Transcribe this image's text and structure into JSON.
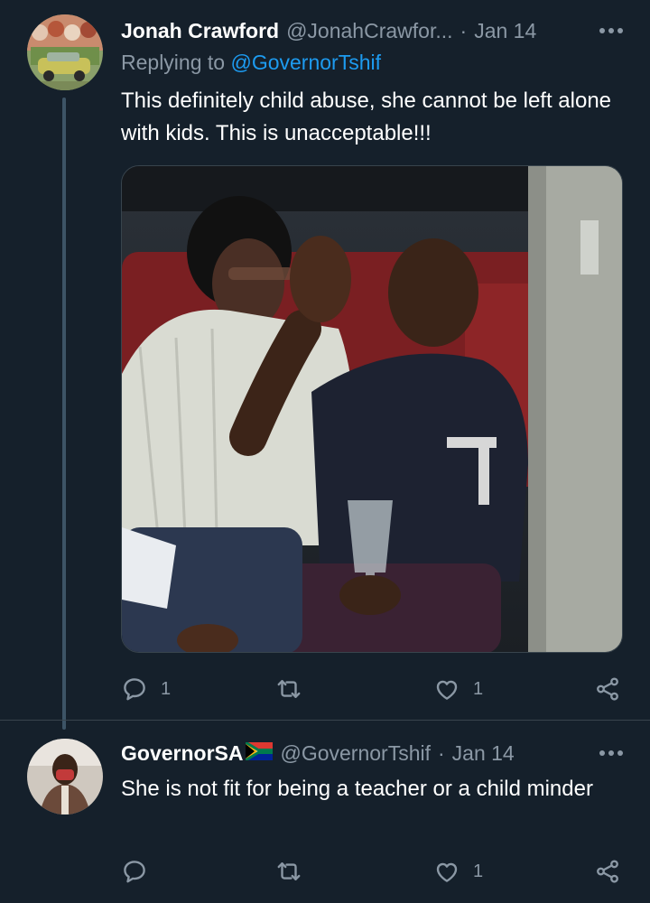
{
  "tweets": [
    {
      "author": {
        "name": "Jonah Crawford",
        "handle": "@JonahCrawfor...",
        "date": "Jan 14",
        "separator": "·"
      },
      "replying_prefix": "Replying to",
      "replying_to": "@GovernorTshif",
      "text": "This definitely child abuse, she cannot be left alone with kids. This is unacceptable!!!",
      "actions": {
        "reply_count": "1",
        "retweet_count": "",
        "like_count": "1"
      }
    },
    {
      "author": {
        "name": "GovernorSA",
        "handle": "@GovernorTshif",
        "date": "Jan 14",
        "separator": "·"
      },
      "text": "She is not fit for being a teacher or a child minder",
      "actions": {
        "reply_count": "",
        "retweet_count": "",
        "like_count": "1"
      }
    }
  ],
  "colors": {
    "background": "#15202b",
    "text_primary": "#ffffff",
    "text_secondary": "#8b98a5",
    "link": "#1d9bf0",
    "border": "#38444d"
  },
  "icons": [
    "reply-icon",
    "retweet-icon",
    "like-icon",
    "share-icon",
    "more-icon",
    "south-africa-flag-emoji"
  ]
}
